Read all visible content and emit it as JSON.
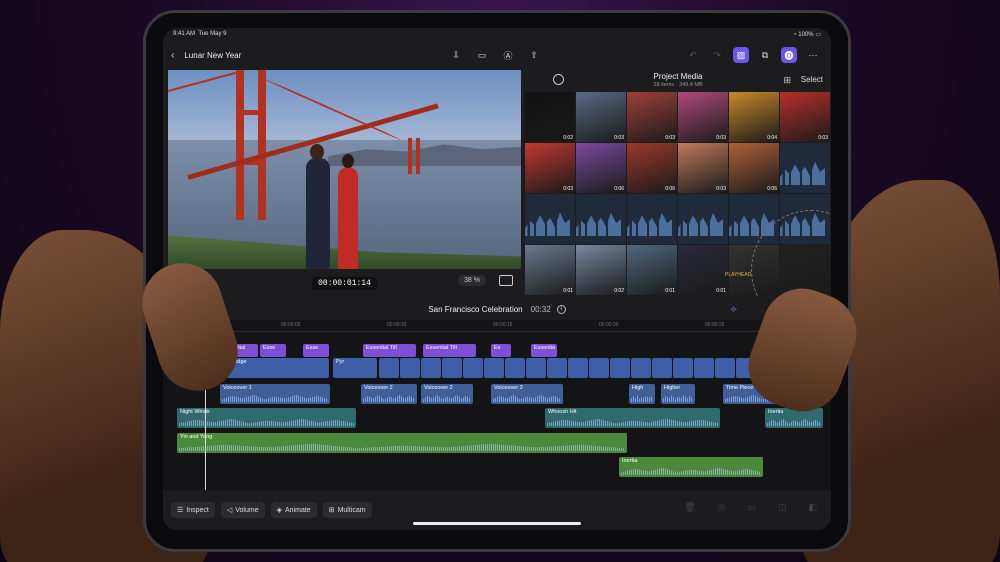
{
  "status": {
    "time": "9:41 AM",
    "date": "Tue May 9",
    "battery": "100%"
  },
  "project": {
    "title": "Lunar New Year"
  },
  "viewer": {
    "timecode": "00:00:01:14",
    "zoom": "38"
  },
  "browser": {
    "title": "Project Media",
    "subtitle": "28 items · 349.4 MB",
    "select_label": "Select",
    "durations": [
      "0:02",
      "0:03",
      "0:03",
      "0:03",
      "0:04",
      "0:03",
      "0:03",
      "0:06",
      "0:06",
      "0:03",
      "0:06",
      "",
      "",
      "",
      "",
      "",
      "",
      "",
      "0:01",
      "0:02",
      "0:01",
      "0:01",
      "",
      ""
    ]
  },
  "timeline": {
    "project_name": "San Francisco Celebration",
    "duration": "00:32",
    "ruler": [
      "00:00:05",
      "00:00:10",
      "00:00:15",
      "00:00:20",
      "00:00:25"
    ],
    "titles": [
      "Essential",
      "Esse",
      "Esse",
      "Essential Titl",
      "Essential Titl",
      "Es",
      "Essentia"
    ],
    "video": [
      "Golden Gate Bridge",
      "Pyr"
    ],
    "voiceovers": [
      "Voiceover 1",
      "Voiceover 2",
      "Voiceover 2",
      "Voiceover 3",
      "High",
      "Higher",
      "Time Piece"
    ],
    "sfx": [
      "Night Winds",
      "Whoosh Hit",
      "Inertia"
    ],
    "music": [
      "Yin and Yang",
      "Inertia"
    ]
  },
  "toolbar": {
    "inspect": "Inspect",
    "volume": "Volume",
    "animate": "Animate",
    "multicam": "Multicam"
  },
  "jog": {
    "playhead_label": "PLAYHEAD"
  }
}
